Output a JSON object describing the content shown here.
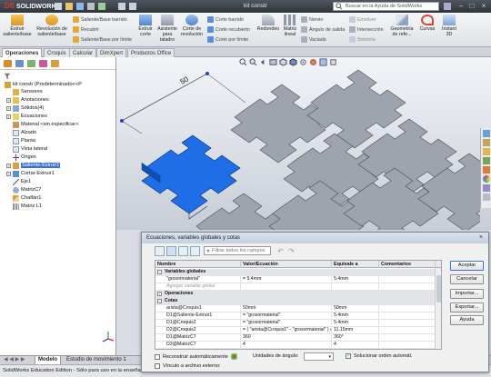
{
  "titlebar": {
    "logo": "SOLIDWORKS",
    "title": "kit constr",
    "help_search_placeholder": "Buscar en la Ayuda de SolidWorks",
    "brand_color": "#e23a2f"
  },
  "ribbon": {
    "extrude_boss": "Extruir saliente/base",
    "revolve_boss": "Revolución de saliente/base",
    "swept_boss": "Saliente/Base barrido",
    "lofted_boss": "Recubrir",
    "boundary_boss": "Saliente/Base por límite",
    "extruded_cut": "Extruir corte",
    "hole_wizard": "Asistente para taladro",
    "revolved_cut": "Corte de revolución",
    "swept_cut": "Corte barrido",
    "lofted_cut": "Corte recubierto",
    "boundary_cut": "Corte por límite",
    "fillet": "Redondeo",
    "linear_pattern": "Matriz lineal",
    "rib": "Nervio",
    "draft": "Ángulo de salida",
    "shell": "Vaciado",
    "wrap": "Envolver",
    "intersect": "Intersección",
    "mirror": "Simetría",
    "ref_geometry": "Geometría de refe...",
    "curves": "Curvas",
    "instant3d": "Instant 3D"
  },
  "tabs": [
    "Operaciones",
    "Croquis",
    "Calcular",
    "DimXpert",
    "Productos Office"
  ],
  "tree": {
    "root": "kit constr  (Predeterminado<<P",
    "items": [
      "Sensores",
      "Anotaciones",
      "Sólidos(4)",
      "Ecuaciones",
      "Material <sin especificar>",
      "Alzado",
      "Planta",
      "Vista lateral",
      "Origen",
      "Saliente-Extruir1",
      "Cortar-Extruir1",
      "Eje1",
      "MatrizC7",
      "Chaflán1",
      "Matriz L1"
    ]
  },
  "viewport": {
    "dimension_value": "50",
    "selected_color": "#1f6ee8",
    "part_color": "#9ea4ad"
  },
  "dialog": {
    "title": "Ecuaciones, variables globales y cotas",
    "filter_placeholder": "Filtrar todos los campos",
    "columns": [
      "Nombre",
      "Valor/Ecuación",
      "Equivale a",
      "Comentarios"
    ],
    "rows": [
      {
        "kind": "section",
        "name": "Variables globales",
        "value": "",
        "eval": "",
        "comment": ""
      },
      {
        "kind": "row",
        "name": "\"grosormaterial\"",
        "value": "= 5.4mm",
        "eval": "5.4mm",
        "comment": ""
      },
      {
        "kind": "hint",
        "name": "Agregar variable global",
        "value": "",
        "eval": "",
        "comment": ""
      },
      {
        "kind": "section",
        "name": "Operaciones",
        "value": "",
        "eval": "",
        "comment": ""
      },
      {
        "kind": "section",
        "name": "Cotas",
        "value": "",
        "eval": "",
        "comment": ""
      },
      {
        "kind": "row",
        "name": "arista@Croquis1",
        "value": "50mm",
        "eval": "50mm",
        "comment": ""
      },
      {
        "kind": "row",
        "name": "D1@Saliente-Extruir1",
        "value": "= \"grosormaterial\"",
        "eval": "5.4mm",
        "comment": ""
      },
      {
        "kind": "row",
        "name": "D1@Croquis2",
        "value": "= \"grosormaterial\"",
        "eval": "5.4mm",
        "comment": ""
      },
      {
        "kind": "row",
        "name": "D2@Croquis2",
        "value": "= ( \"arista@Croquis1\" - \"grosormaterial\" ) / 4",
        "eval": "11.15mm",
        "comment": ""
      },
      {
        "kind": "row",
        "name": "D1@MatrizC7",
        "value": "360",
        "eval": "360°",
        "comment": ""
      },
      {
        "kind": "row",
        "name": "D3@MatrizC7",
        "value": "4",
        "eval": "4",
        "comment": ""
      }
    ],
    "buttons": [
      "Aceptar",
      "Cancelar",
      "Importar...",
      "Exportar...",
      "Ayuda"
    ],
    "auto_rebuild": "Reconstruir automáticamente",
    "angle_units_label": "Unidades de ángulo:",
    "angle_units_value": "",
    "auto_solve": "Solucionar orden automát.",
    "link_external": "Vínculo a archivo externo:"
  },
  "model_tabs": [
    "Modelo",
    "Estudio de movimiento 1"
  ],
  "status": "SolidWorks Education Edition - Sólo para uso en la enseñanza"
}
